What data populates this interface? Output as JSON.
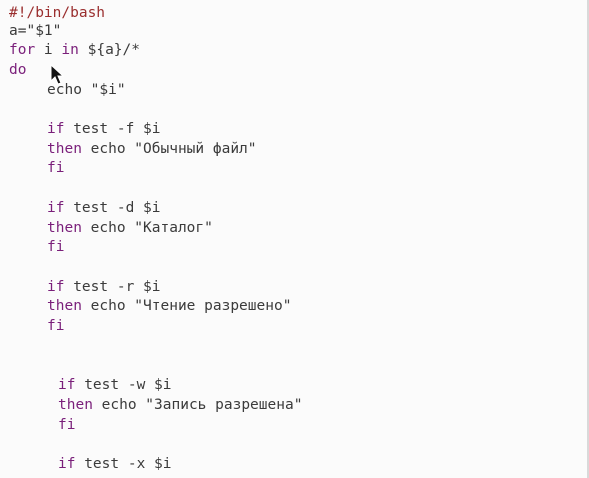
{
  "editor": {
    "lines": [
      {
        "parts": [
          {
            "t": "#!/bin/bash",
            "c": "comment"
          }
        ]
      },
      {
        "parts": [
          {
            "t": "a=\"$1\"",
            "c": "txt"
          }
        ]
      },
      {
        "parts": [
          {
            "t": "for",
            "c": "kw"
          },
          {
            "t": " i ",
            "c": "txt"
          },
          {
            "t": "in",
            "c": "kw"
          },
          {
            "t": " ${a}/*",
            "c": "txt"
          }
        ]
      },
      {
        "parts": [
          {
            "t": "do",
            "c": "kw"
          }
        ]
      },
      {
        "parts": [
          {
            "t": "echo \"$i\"",
            "c": "txt"
          }
        ]
      },
      {
        "parts": []
      },
      {
        "parts": [
          {
            "t": "if",
            "c": "kw"
          },
          {
            "t": " test -f $i",
            "c": "txt"
          }
        ]
      },
      {
        "parts": [
          {
            "t": "then",
            "c": "kw"
          },
          {
            "t": " echo \"Обычный файл\"",
            "c": "txt"
          }
        ]
      },
      {
        "parts": [
          {
            "t": "fi",
            "c": "kw"
          }
        ]
      },
      {
        "parts": []
      },
      {
        "parts": [
          {
            "t": "if",
            "c": "kw"
          },
          {
            "t": " test -d $i",
            "c": "txt"
          }
        ]
      },
      {
        "parts": [
          {
            "t": "then",
            "c": "kw"
          },
          {
            "t": " echo \"Каталог\"",
            "c": "txt"
          }
        ]
      },
      {
        "parts": [
          {
            "t": "fi",
            "c": "kw"
          }
        ]
      },
      {
        "parts": []
      },
      {
        "parts": [
          {
            "t": "if",
            "c": "kw"
          },
          {
            "t": " test -r $i",
            "c": "txt"
          }
        ]
      },
      {
        "parts": [
          {
            "t": "then",
            "c": "kw"
          },
          {
            "t": " echo \"Чтение разрешено\"",
            "c": "txt"
          }
        ]
      },
      {
        "parts": [
          {
            "t": "fi",
            "c": "kw"
          }
        ]
      },
      {
        "parts": []
      },
      {
        "parts": []
      },
      {
        "parts": [
          {
            "t": "if",
            "c": "kw"
          },
          {
            "t": " test -w $i",
            "c": "txt"
          }
        ]
      },
      {
        "parts": [
          {
            "t": "then",
            "c": "kw"
          },
          {
            "t": " echo \"Запись разрешена\"",
            "c": "txt"
          }
        ]
      },
      {
        "parts": [
          {
            "t": "fi",
            "c": "kw"
          }
        ]
      },
      {
        "parts": []
      },
      {
        "parts": [
          {
            "t": "if",
            "c": "kw"
          },
          {
            "t": " test -x $i",
            "c": "txt"
          }
        ]
      }
    ]
  },
  "colors": {
    "keyword": "#7a1f7a",
    "text": "#3b3b3b",
    "shebang": "#9a2e2e",
    "background": "#fbfbfb"
  },
  "icons": {
    "pointer": "mouse-pointer-icon"
  }
}
